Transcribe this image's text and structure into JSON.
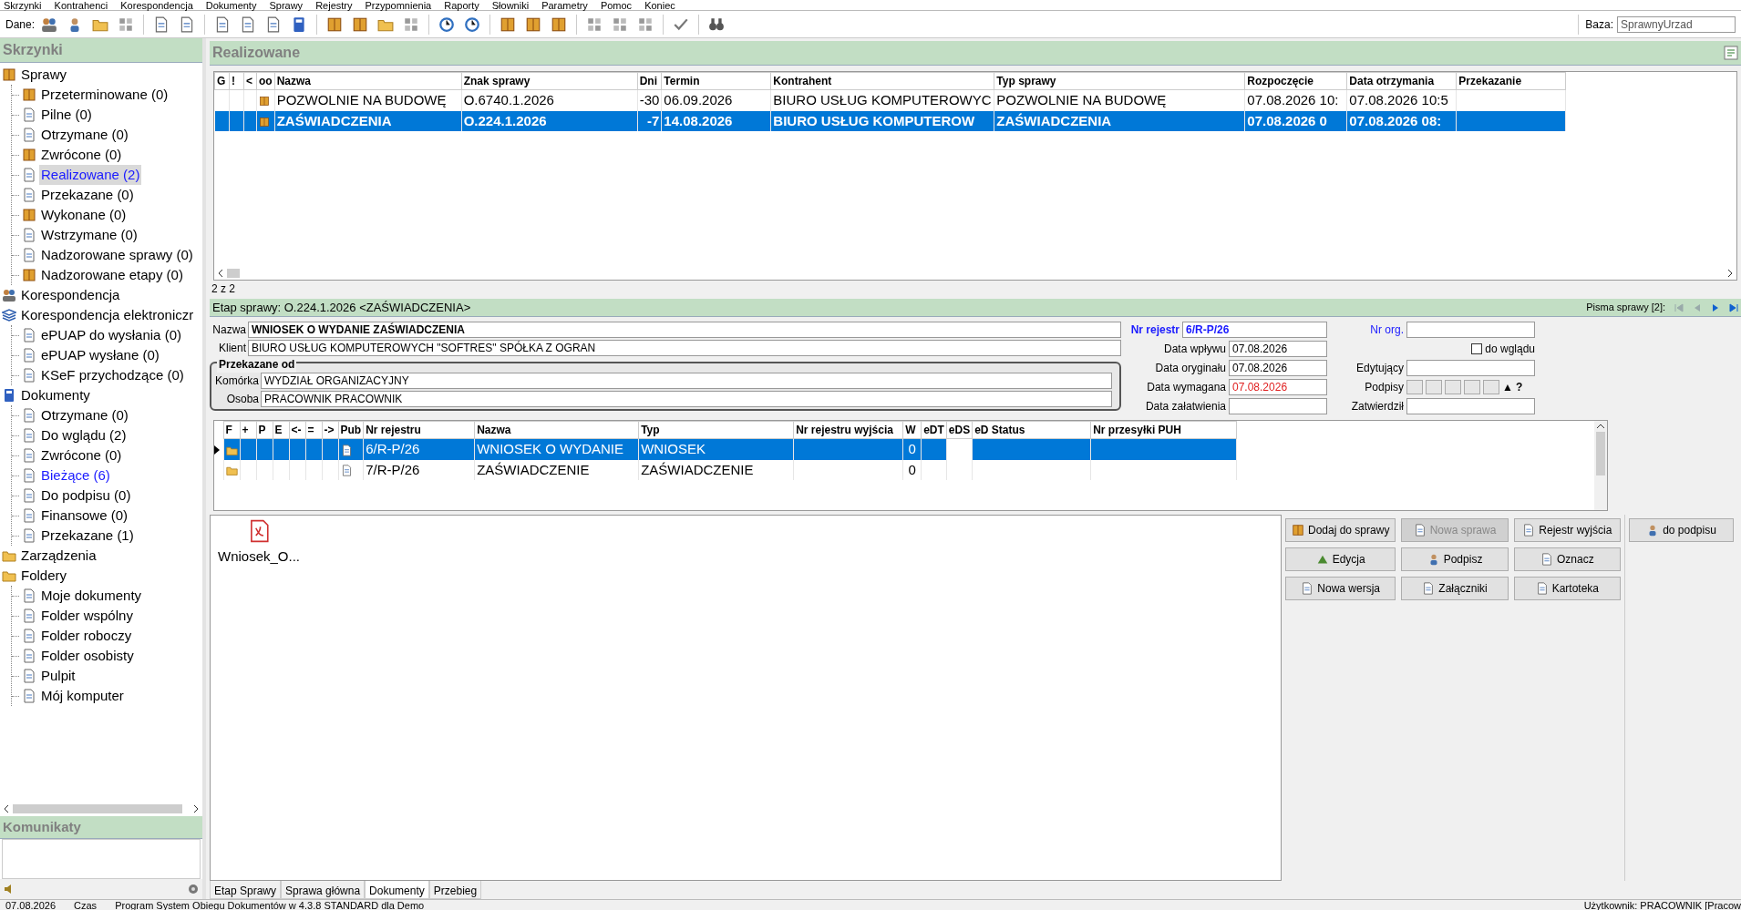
{
  "menu": [
    "Skrzynki",
    "Kontrahenci",
    "Korespondencja",
    "Dokumenty",
    "Sprawy",
    "Rejestry",
    "Przypomnienia",
    "Raporty",
    "Słowniki",
    "Parametry",
    "Pomoc",
    "Koniec"
  ],
  "toolbar": {
    "label": "Dane:",
    "base_label": "Baza:",
    "base_value": "SprawnyUrzad"
  },
  "sidebar": {
    "title": "Skrzynki",
    "tree": [
      {
        "label": "Sprawy",
        "selected": false,
        "focused": false,
        "children": [
          {
            "label": "Przeterminowane (0)",
            "selected": false,
            "focused": false
          },
          {
            "label": "Pilne (0)",
            "selected": false,
            "focused": false
          },
          {
            "label": "Otrzymane (0)",
            "selected": false,
            "focused": false
          },
          {
            "label": "Zwrócone (0)",
            "selected": false,
            "focused": false
          },
          {
            "label": "Realizowane (2)",
            "selected": true,
            "focused": true
          },
          {
            "label": "Przekazane (0)",
            "selected": false,
            "focused": false
          },
          {
            "label": "Wykonane (0)",
            "selected": false,
            "focused": false
          },
          {
            "label": "Wstrzymane (0)",
            "selected": false,
            "focused": false
          },
          {
            "label": "Nadzorowane sprawy (0)",
            "selected": false,
            "focused": false
          },
          {
            "label": "Nadzorowane etapy (0)",
            "selected": false,
            "focused": false
          }
        ]
      },
      {
        "label": "Korespondencja",
        "selected": false,
        "focused": false
      },
      {
        "label": "Korespondencja elektroniczr",
        "selected": false,
        "focused": false,
        "children": [
          {
            "label": "ePUAP do wysłania (0)",
            "selected": false,
            "focused": false
          },
          {
            "label": "ePUAP wysłane (0)",
            "selected": false,
            "focused": false
          },
          {
            "label": "KSeF przychodzące (0)",
            "selected": false,
            "focused": false
          }
        ]
      },
      {
        "label": "Dokumenty",
        "selected": false,
        "focused": false,
        "children": [
          {
            "label": "Otrzymane (0)",
            "selected": false,
            "focused": false
          },
          {
            "label": "Do wglądu (2)",
            "selected": false,
            "focused": false
          },
          {
            "label": "Zwrócone (0)",
            "selected": false,
            "focused": false
          },
          {
            "label": "Bieżące (6)",
            "selected": true,
            "focused": false
          },
          {
            "label": "Do podpisu (0)",
            "selected": false,
            "focused": false
          },
          {
            "label": "Finansowe (0)",
            "selected": false,
            "focused": false
          },
          {
            "label": "Przekazane (1)",
            "selected": false,
            "focused": false
          }
        ]
      },
      {
        "label": "Zarządzenia",
        "selected": false,
        "focused": false
      },
      {
        "label": "Foldery",
        "selected": false,
        "focused": false,
        "children": [
          {
            "label": "Moje dokumenty",
            "selected": false,
            "focused": false
          },
          {
            "label": "Folder wspólny",
            "selected": false,
            "focused": false
          },
          {
            "label": "Folder roboczy",
            "selected": false,
            "focused": false
          },
          {
            "label": "Folder osobisty",
            "selected": false,
            "focused": false
          },
          {
            "label": "Pulpit",
            "selected": false,
            "focused": false
          },
          {
            "label": "Mój komputer",
            "selected": false,
            "focused": false
          }
        ]
      }
    ]
  },
  "messages": {
    "title": "Komunikaty"
  },
  "cases": {
    "title": "Realizowane",
    "columns": [
      "G",
      "!",
      "<",
      "oo",
      "Nazwa",
      "Znak sprawy",
      "Dni",
      "Termin",
      "Kontrahent",
      "Typ sprawy",
      "Rozpoczęcie",
      "Data otrzymania",
      "Przekazanie"
    ],
    "rows": [
      {
        "selected": false,
        "name": "POZWOLNIE NA BUDOWĘ",
        "sign": "O.6740.1.2026",
        "days": "-30",
        "term": "06.09.2026",
        "contractor": "BIURO USŁUG KOMPUTEROWYC",
        "type": "POZWOLNIE NA BUDOWĘ",
        "started": "07.08.2026 10:",
        "received": "07.08.2026 10:5"
      },
      {
        "selected": true,
        "name": "ZAŚWIADCZENIA",
        "sign": "O.224.1.2026",
        "days": "-7",
        "term": "14.08.2026",
        "contractor": "BIURO USŁUG KOMPUTEROW",
        "type": "ZAŚWIADCZENIA",
        "started": "07.08.2026 0",
        "received": "07.08.2026 08:"
      }
    ],
    "count": "2 z 2"
  },
  "stage": {
    "title": "Etap sprawy: O.224.1.2026 <ZAŚWIADCZENIA>",
    "letters_label": "Pisma sprawy [2]:",
    "name_label": "Nazwa",
    "name": "WNIOSEK O WYDANIE ZAŚWIADCZENIA",
    "client_label": "Klient",
    "client": "BIURO USŁUG KOMPUTEROWYCH \"SOFTRES\" SPÓŁKA Z OGRAN",
    "from_title": "Przekazane od",
    "unit_label": "Komórka",
    "unit": "WYDZIAŁ ORGANIZACYJNY",
    "person_label": "Osoba",
    "person": "PRACOWNIK PRACOWNIK",
    "register_label": "Nr rejestr",
    "register": "6/R-P/26",
    "dates": [
      {
        "label": "Data wpływu",
        "value": "07.08.2026",
        "overdue": false
      },
      {
        "label": "Data oryginału",
        "value": "07.08.2026",
        "overdue": false
      },
      {
        "label": "Data wymagana",
        "value": "07.08.2026",
        "overdue": true
      },
      {
        "label": "Data załatwienia"
      }
    ],
    "org_label": "Nr org.",
    "review_label": "do wglądu",
    "review_checked": false,
    "editor_label": "Edytujący",
    "signatures_label": "Podpisy",
    "signatures_up": "▲",
    "signatures_help": "?",
    "approved_label": "Zatwierdził"
  },
  "documents": {
    "columns": [
      "F",
      "+",
      "P",
      "E",
      "<-",
      "=",
      "->",
      "Pub",
      "Nr rejestru",
      "Nazwa",
      "Typ",
      "Nr rejestru wyjścia",
      "W",
      "eDT",
      "eDS",
      "eD Status",
      "Nr przesyłki PUH"
    ],
    "rows": [
      {
        "selected": true,
        "register": "6/R-P/26",
        "name": "WNIOSEK O WYDANIE",
        "type": "WNIOSEK",
        "w": "0"
      },
      {
        "selected": false,
        "register": "7/R-P/26",
        "name": "ZAŚWIADCZENIE",
        "type": "ZAŚWIADCZENIE",
        "w": "0"
      }
    ]
  },
  "attachments": [
    {
      "name": "Wniosek_O..."
    }
  ],
  "buttons": [
    {
      "label": "Dodaj do sprawy",
      "disabled": false
    },
    {
      "label": "Nowa sprawa",
      "disabled": true
    },
    {
      "label": "Rejestr wyjścia",
      "disabled": false
    },
    {
      "label": "Edycja",
      "disabled": false
    },
    {
      "label": "Podpisz",
      "disabled": false
    },
    {
      "label": "Oznacz",
      "disabled": false
    },
    {
      "label": "Nowa wersja",
      "disabled": false
    },
    {
      "label": "Załączniki",
      "disabled": false
    },
    {
      "label": "Kartoteka",
      "disabled": false
    }
  ],
  "side_button": {
    "label": "do podpisu"
  },
  "tabs": [
    {
      "label": "Etap Sprawy",
      "selected": false
    },
    {
      "label": "Sprawa główna",
      "selected": false
    },
    {
      "label": "Dokumenty",
      "selected": true
    },
    {
      "label": "Przebieg",
      "selected": false
    }
  ],
  "status_bar": [
    "07.08.2026",
    "Czas",
    "Program System Obiegu Dokumentów w 4.3.8 STANDARD dla Demo",
    "Użytkownik: PRACOWNIK [Pracow"
  ]
}
